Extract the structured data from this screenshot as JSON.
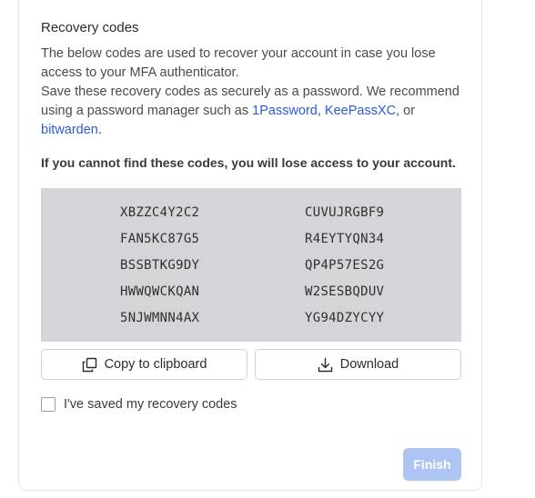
{
  "title": "Recovery codes",
  "description": {
    "line1": "The below codes are used to recover your account in case you lose access to your MFA authenticator.",
    "line2_prefix": "Save these recovery codes as securely as a password. We recommend using a password manager such as ",
    "link_1password": "1Password",
    "sep1": ", ",
    "link_keepassxc": "KeePassXC",
    "sep2": ", or ",
    "link_bitwarden": "bitwarden",
    "suffix": "."
  },
  "warning": "If you cannot find these codes, you will lose access to your account.",
  "codes": {
    "left": [
      "XBZZC4Y2C2",
      "FAN5KC87G5",
      "BSSBTKG9DY",
      "HWWQWCKQAN",
      "5NJWMNN4AX"
    ],
    "right": [
      "CUVUJRGBF9",
      "R4EYTYQN34",
      "QP4P57ES2G",
      "W2SESBQDUV",
      "YG94DZYCYY"
    ]
  },
  "buttons": {
    "copy_label": "Copy to clipboard",
    "copy_icon": "copy-icon",
    "download_label": "Download",
    "download_icon": "download-icon",
    "finish_label": "Finish"
  },
  "checkbox": {
    "label": "I've saved my recovery codes",
    "checked": false
  },
  "colors": {
    "link": "#2a5bd7",
    "codes_bg": "#d3d5d9",
    "finish_disabled_bg": "#aec4f2"
  }
}
